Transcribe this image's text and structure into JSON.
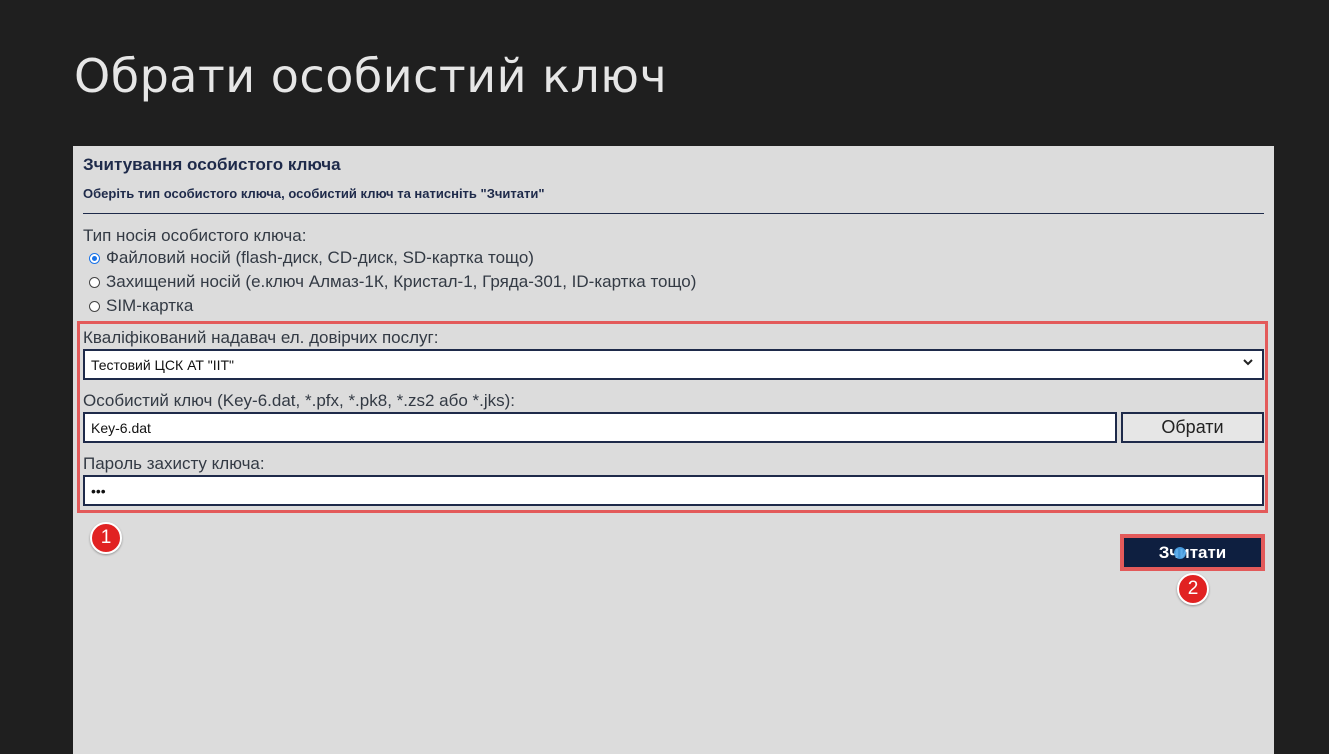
{
  "page": {
    "title": "Обрати особистий ключ"
  },
  "panel": {
    "title": "Зчитування особистого ключа",
    "subtitle": "Оберіть тип особистого ключа, особистий ключ та натисніть \"Зчитати\"",
    "media_type_label": "Тип носія особистого ключа:",
    "media_options": [
      {
        "label": "Файловий носій (flash-диск, CD-диск, SD-картка тощо)",
        "checked": true
      },
      {
        "label": "Захищений носій (е.ключ Алмаз-1К, Кристал-1, Гряда-301, ID-картка тощо)",
        "checked": false
      },
      {
        "label": "SIM-картка",
        "checked": false
      }
    ],
    "provider_label": "Кваліфікований надавач ел. довірчих послуг:",
    "provider_value": "Тестовий ЦСК АТ \"ІІТ\"",
    "key_label": "Особистий ключ (Key-6.dat, *.pfx, *.pk8, *.zs2 або *.jks):",
    "key_value": "Key-6.dat",
    "browse_button": "Обрати",
    "password_label": "Пароль захисту ключа:",
    "password_value": "•••",
    "read_button": "Зчитати"
  },
  "annotations": {
    "step1": "1",
    "step2": "2",
    "highlight_color": "#e35a5a",
    "badge_color": "#e12222"
  },
  "icons": {
    "select_chevron": "chevron-down-icon",
    "pointer": "hand-pointer-icon"
  }
}
